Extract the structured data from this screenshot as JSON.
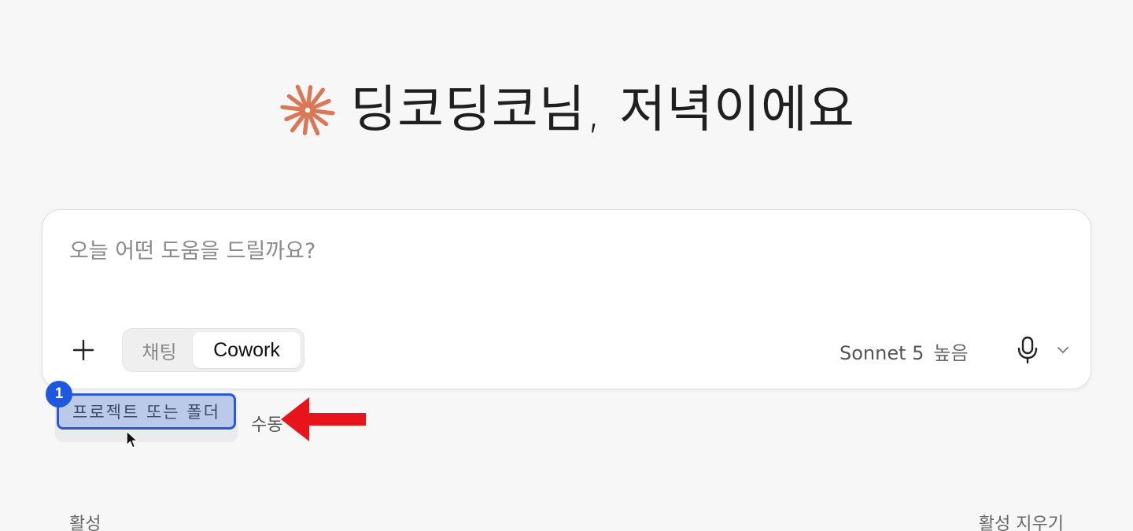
{
  "greeting": {
    "text": "딩코딩코님, 저녁이에요",
    "logo_icon": "sparkle-asterisk-icon",
    "logo_color": "#d97757"
  },
  "composer": {
    "placeholder": "오늘 어떤 도움을 드릴까요?",
    "add_icon": "plus-icon",
    "mode_tabs": [
      {
        "label": "채팅",
        "selected": false
      },
      {
        "label": "Cowork",
        "selected": true
      }
    ],
    "model": "Sonnet 5",
    "effort": "높음",
    "mic_icon": "microphone-icon",
    "dropdown_icon": "chevron-down-icon"
  },
  "below_composer": {
    "project_chip_label": "프로젝트 또는 폴더",
    "step_badge": "1",
    "step_badge_color": "#1f58e0",
    "highlight_color": "#2b59d6",
    "manual_label": "수동",
    "arrow_color": "#e8141c"
  },
  "footer": {
    "active_label": "활성",
    "clear_active_label": "활성 지우기"
  }
}
